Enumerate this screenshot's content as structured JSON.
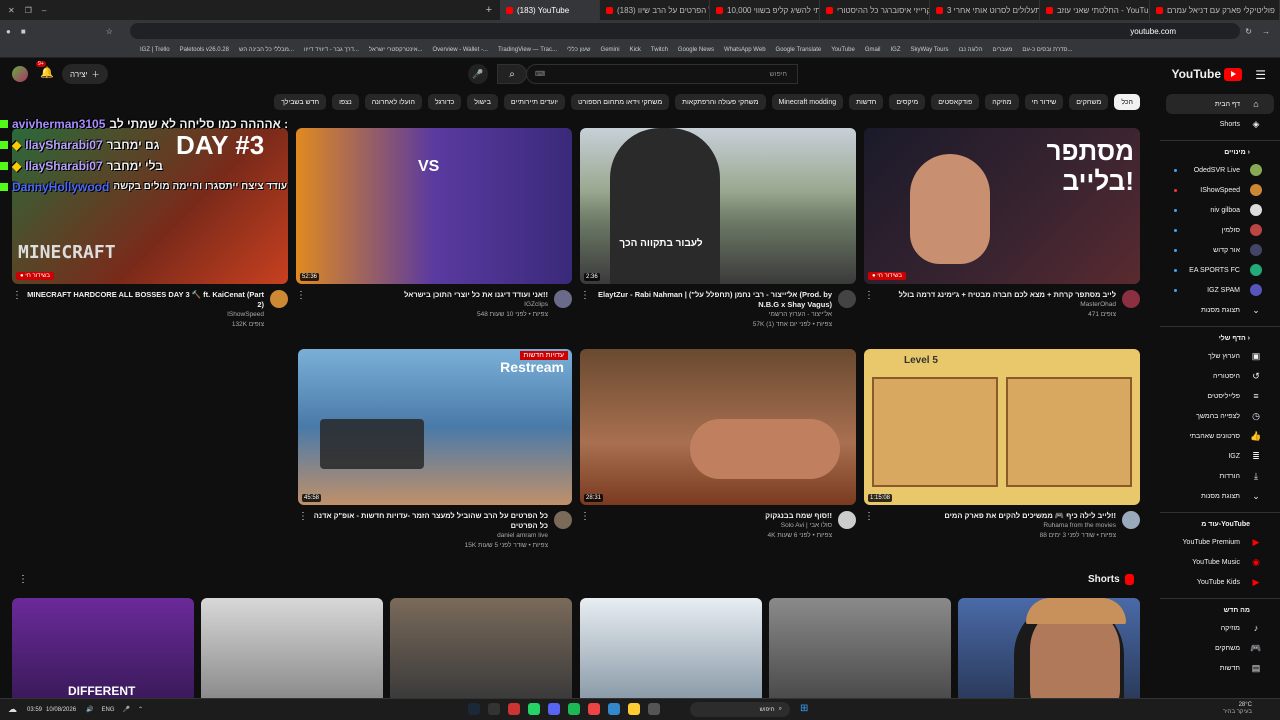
{
  "browser": {
    "tabs": [
      {
        "title": "פוליטיקלי פארק עם דניאל עמרם"
      },
      {
        "title": "החלטתי שאני עוזב - YouTube"
      },
      {
        "title": "תעלולים לסרוט אותי אחרי 3"
      },
      {
        "title": "אבא קרייזי איסוברגר כל ההיסטורי"
      },
      {
        "title": "ניסיתי להשיג קליפ בשווי 10,000"
      },
      {
        "title": "(183) כל הפרטים על הרב שיוו"
      },
      {
        "title": "(183) YouTube"
      }
    ],
    "new_tab": "+",
    "url": "youtube.com",
    "bookmarks": [
      "IGZ | Trello",
      "Paletools v26.0.28",
      "מבללי כל הבינה הש...",
      "דרך גבר - דיוויד דייוו...",
      "אינטרקסטרי ישראל...",
      "Overview - Wallet -...",
      "TradingView — Trac...",
      "שעון כללי",
      "Gemini",
      "Kick",
      "Twitch",
      "Google News",
      "WhatsApp Web",
      "Google Translate",
      "YouTube",
      "Gmail",
      "IGZ",
      "SkyWay Tours",
      "הלוגה נבו",
      "מעברים",
      "סדרת ובסים כ-עם..."
    ]
  },
  "masthead": {
    "logo_text": "YouTube",
    "search_placeholder": "חיפוש",
    "create_label": "יצירה",
    "notifications_count": "9+"
  },
  "chips": [
    "הכל",
    "משחקים",
    "שידור חי",
    "מוזיקה",
    "פודקאסטים",
    "מיקסים",
    "חדשות",
    "Minecraft modding",
    "משחקי פעולה והרפתקאות",
    "משחקי וידאו מתחום הספורט",
    "יועדים תיירותיים",
    "בישול",
    "כדורגל",
    "הועלו לאחרונה",
    "נצפו",
    "חדש בשבילך"
  ],
  "sidebar": {
    "main": [
      {
        "label": "דף הבית",
        "icon": "home-icon"
      },
      {
        "label": "Shorts",
        "icon": "shorts-icon"
      }
    ],
    "subs_header": "מינויים",
    "subscriptions": [
      {
        "label": "OdedSVR Live",
        "color": "#8a5"
      },
      {
        "label": "IShowSpeed",
        "color": "#c83"
      },
      {
        "label": "niv gilboa",
        "color": "#ddd"
      },
      {
        "label": "סולמין",
        "color": "#b44"
      },
      {
        "label": "אור קדוש",
        "color": "#446"
      },
      {
        "label": "EA SPORTS FC",
        "color": "#2a7"
      },
      {
        "label": "IGZ SPAM",
        "color": "#55b"
      }
    ],
    "show_more": "תצוגת מסנות",
    "you_header": "הדף שלי",
    "you": [
      {
        "label": "הערוץ שלך",
        "icon": "channel-icon"
      },
      {
        "label": "היסטוריה",
        "icon": "history-icon"
      },
      {
        "label": "פלייליסטים",
        "icon": "playlist-icon"
      },
      {
        "label": "לצפייה בהמשך",
        "icon": "clock-icon"
      },
      {
        "label": "סרטונים שאהבתי",
        "icon": "like-icon"
      },
      {
        "label": "IGZ",
        "icon": "list-icon"
      },
      {
        "label": "הורדות",
        "icon": "download-icon"
      },
      {
        "label": "תצוגת מסנות",
        "icon": "chevron-down-icon"
      }
    ],
    "more_header": "עוד מ-YouTube",
    "more": [
      {
        "label": "YouTube Premium"
      },
      {
        "label": "YouTube Music"
      },
      {
        "label": "YouTube Kids"
      }
    ],
    "new_header": "מה חדש",
    "new": [
      {
        "label": "מוזיקה",
        "icon": "music-icon"
      },
      {
        "label": "משחקים",
        "icon": "gaming-icon"
      },
      {
        "label": "חדשות",
        "icon": "news-icon"
      }
    ]
  },
  "videos": [
    {
      "title": "לייב מסתפר קרחת + מצא לכם חברה מבטיח + ג'ימינג דרמה בולל",
      "channel": "MasterOhad",
      "stats": "471 צופים",
      "duration": "",
      "live": true,
      "bg": "#2d1a22",
      "thumb_text": "מסתפר בלייב!"
    },
    {
      "title": "ElaytZur - Rabi Nahman | אל'ייצור - רבי נחמן (תחפלל על\") (Prod. by N.B.G x Shay Vagus)",
      "channel": "אל'ייצור - הערוץ הרשמי",
      "stats": "57K צפיות • לפני יום אחד (1)",
      "duration": "2:36",
      "live": false,
      "bg": "#6c7a66",
      "thumb_text": "לעבור בתקווה הכך"
    },
    {
      "title": "אני ועודד דיגנו את כל יוצרי התוכן בישראל!!",
      "channel": "IGZclips",
      "stats": "548 צפיות • לפני 10 שעות",
      "duration": "52:36",
      "live": false,
      "bg": "#3c2a6e",
      "thumb_text": "VS"
    },
    {
      "title": "MINECRAFT HARDCORE ALL BOSSES DAY 3 🔨 ft. KaiCenat (Part 2)",
      "channel": "IShowSpeed",
      "stats": "132K צופים",
      "duration": "",
      "live": true,
      "bg": "#7a2a1a",
      "thumb_text": "DAY #3"
    },
    {
      "title": "לייב לילה כיף 🎮 ממשיכים להקים את פארק המים!!",
      "channel": "Ruhama from the movies",
      "stats": "88 צפיות • שודר לפני 3 ימים",
      "duration": "1:15:08",
      "live": false,
      "bg": "#e8c86a",
      "thumb_text": "Level 5"
    },
    {
      "title": "סוף שמח בבנגקוק!!",
      "channel": "Solo Avi | סולו אבי",
      "stats": "4K צפיות • לפני 6 שעות",
      "duration": "28:31",
      "live": false,
      "bg": "#8a5a3a",
      "thumb_text": ""
    },
    {
      "title": "כל הפרטים על הרב שהוביל למעצר הזמר -עדויות חדשות - אופ\"ק אדנה כל הפרטים",
      "channel": "daniel amram live",
      "stats": "15K צפיות • שודר לפני 5 שעות",
      "duration": "45:58",
      "live": false,
      "bg": "#4a7aa8",
      "thumb_text": "Restream"
    }
  ],
  "shorts_header": "Shorts",
  "shorts_colors": [
    "#5a2a8a",
    "#c8c8c8",
    "#6a5a4a",
    "#e8e8e8",
    "#7a7a7a",
    "#4a5a8a"
  ],
  "chat_overlay": [
    {
      "user": "avivherman3105",
      "text": "אהההה כמו סליחה לא שמתי לב :"
    },
    {
      "user": "IlaySharabi07",
      "text": "גם ימחבר"
    },
    {
      "user": "IlaySharabi07",
      "text": "בלי ימחבר"
    },
    {
      "user": "DannyHollywood",
      "text": "עודד ציצח ייתסגרו והיימה מולים בקשה"
    }
  ],
  "taskbar": {
    "time": "03:59",
    "date": "10/08/2026",
    "lang": "ENG",
    "search_label": "חיפוש",
    "weather": "28°C",
    "weather_desc": "בעיקר בהיר"
  }
}
